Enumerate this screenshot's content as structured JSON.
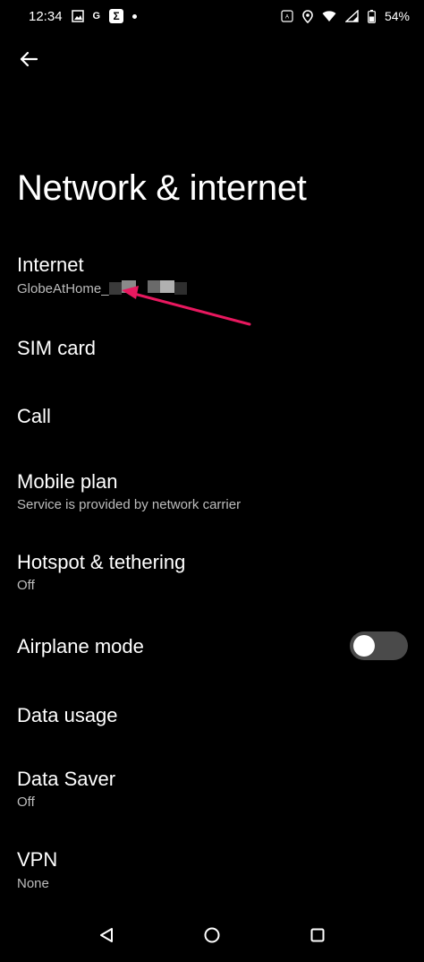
{
  "status_bar": {
    "time": "12:34",
    "notification_letter": "G",
    "sigma_glyph": "Σ",
    "battery_percent": "54%",
    "icons": [
      "image-icon",
      "g-icon",
      "sigma-app-icon",
      "dot-icon",
      "auto-brightness-icon",
      "location-icon",
      "wifi-icon",
      "signal-icon",
      "battery-icon"
    ]
  },
  "header": {
    "back_icon": "arrow-back-icon",
    "title": "Network & internet"
  },
  "settings": {
    "internet": {
      "title": "Internet",
      "subtitle": "GlobeAtHome_"
    },
    "sim_card": {
      "title": "SIM card"
    },
    "call": {
      "title": "Call"
    },
    "mobile_plan": {
      "title": "Mobile plan",
      "subtitle": "Service is provided by network carrier"
    },
    "hotspot": {
      "title": "Hotspot & tethering",
      "subtitle": "Off"
    },
    "airplane_mode": {
      "title": "Airplane mode",
      "enabled": false
    },
    "data_usage": {
      "title": "Data usage"
    },
    "data_saver": {
      "title": "Data Saver",
      "subtitle": "Off"
    },
    "vpn": {
      "title": "VPN",
      "subtitle": "None"
    }
  },
  "annotation": {
    "arrow_color": "#e8185f"
  },
  "nav_bar": {
    "icons": [
      "back-triangle-icon",
      "home-circle-icon",
      "recents-square-icon"
    ]
  }
}
